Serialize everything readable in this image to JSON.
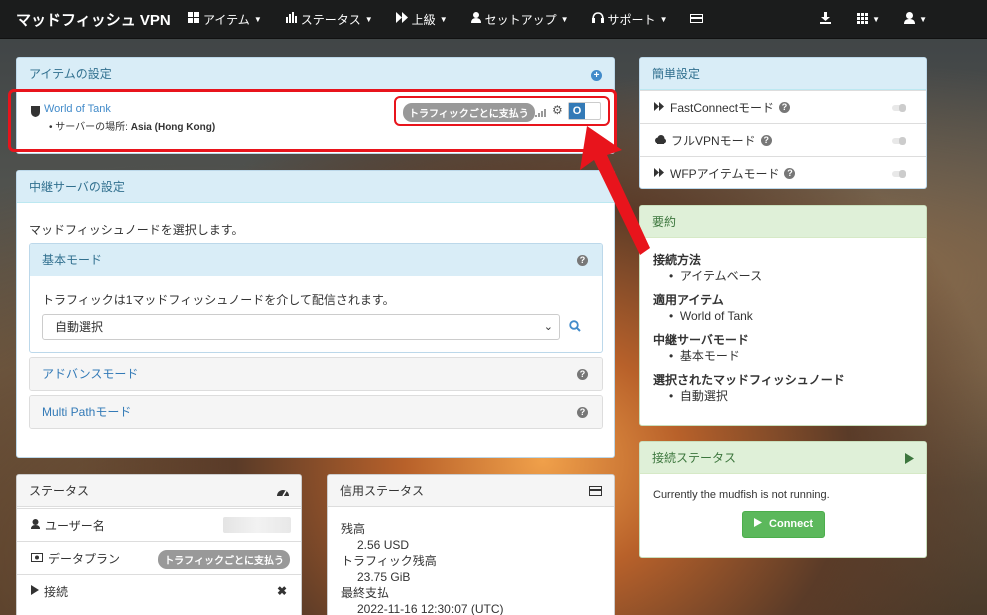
{
  "navbar": {
    "brand": "マッドフィッシュ VPN",
    "items": [
      {
        "icon": "grid-icon",
        "label": "アイテム"
      },
      {
        "icon": "bar-chart-icon",
        "label": "ステータス"
      },
      {
        "icon": "fast-forward-icon",
        "label": "上級"
      },
      {
        "icon": "user-icon",
        "label": "セットアップ"
      },
      {
        "icon": "headphones-icon",
        "label": "サポート"
      }
    ]
  },
  "item_settings": {
    "title": "アイテムの設定",
    "item_name": "World of Tank",
    "location_label": "サーバーの場所: ",
    "location_value": "Asia (Hong Kong)",
    "badge": "トラフィックごとに支払う",
    "toggle_label": "O"
  },
  "relay": {
    "title": "中継サーバの設定",
    "intro": "マッドフィッシュノードを選択します。",
    "basic_mode": "基本モード",
    "basic_desc": "トラフィックは1マッドフィッシュノードを介して配信されます。",
    "select_value": "自動選択",
    "advanced_mode": "アドバンスモード",
    "multipath_mode": "Multi Pathモード"
  },
  "status": {
    "title": "ステータス",
    "rows": [
      {
        "icon": "user-icon",
        "label": "ユーザー名"
      },
      {
        "icon": "id-card-icon",
        "label": "データプラン",
        "badge": "トラフィックごとに支払う"
      },
      {
        "icon": "play-icon",
        "label": "接続"
      }
    ]
  },
  "credit": {
    "title": "信用ステータス",
    "balance_label": "残高",
    "balance_value": "2.56 USD",
    "traffic_label": "トラフィック残高",
    "traffic_value": "23.75 GiB",
    "last_payment_label": "最終支払",
    "last_payment_value": "2022-11-16 12:30:07 (UTC)"
  },
  "quick": {
    "title": "簡単設定",
    "rows": [
      "FastConnectモード",
      "フルVPNモード",
      "WFPアイテムモード"
    ]
  },
  "summary": {
    "title": "要約",
    "sections": [
      {
        "label": "接続方法",
        "value": "アイテムベース"
      },
      {
        "label": "適用アイテム",
        "value": "World of Tank"
      },
      {
        "label": "中継サーバモード",
        "value": "基本モード"
      },
      {
        "label": "選択されたマッドフィッシュノード",
        "value": "自動選択"
      }
    ]
  },
  "connection": {
    "title": "接続ステータス",
    "message": "Currently the mudfish is not running.",
    "button": "Connect"
  },
  "colors": {
    "highlight": "#e8141c",
    "accent": "#428bca",
    "success": "#5cb85c"
  }
}
